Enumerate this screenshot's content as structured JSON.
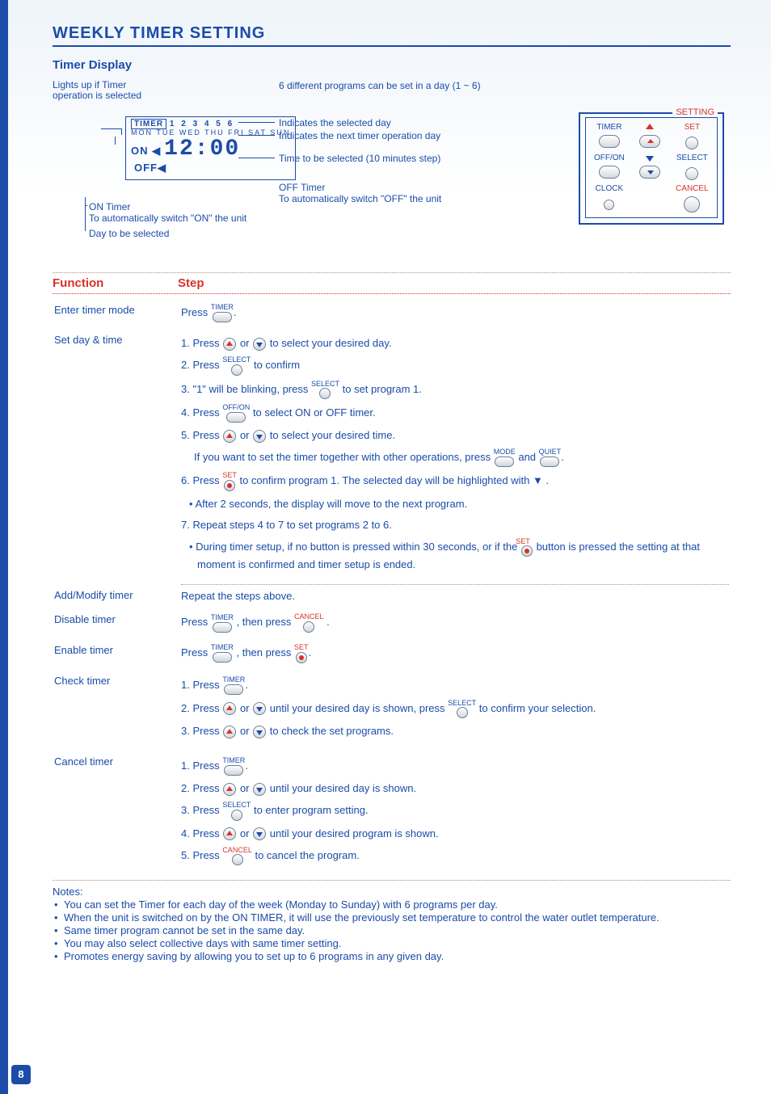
{
  "heading": "WEEKLY TIMER SETTING",
  "timer_display_title": "Timer Display",
  "diagram": {
    "lights_up": "Lights up if Timer operation is selected",
    "six_programs": "6 different programs can be set in a day (1 ~ 6)",
    "indicates_selected": "Indicates the selected day",
    "indicates_next": "Indicates the next timer operation day",
    "time_step": "Time to be selected (10 minutes step)",
    "off_timer_title": "OFF Timer",
    "off_timer_desc": "To automatically switch \"OFF\" the unit",
    "on_timer_title": "ON Timer",
    "on_timer_desc": "To automatically switch \"ON\" the unit",
    "day_selected": "Day to be selected",
    "lcd": {
      "timer_label": "TIMER",
      "nums": "1 2 3 4 5 6",
      "days": "MON TUE WED THU FRI SAT SUN",
      "on": "ON ◀",
      "time": "12:00",
      "off": "OFF◀"
    }
  },
  "panel": {
    "setting": "SETTING",
    "timer": "TIMER",
    "set": "SET",
    "offon": "OFF/ON",
    "select": "SELECT",
    "clock": "CLOCK",
    "cancel": "CANCEL"
  },
  "cols": {
    "function": "Function",
    "step": "Step"
  },
  "rows": {
    "enter": "Enter timer mode",
    "setday": "Set day & time",
    "addmod": "Add/Modify timer",
    "disable": "Disable timer",
    "enable": "Enable timer",
    "check": "Check timer",
    "cancel": "Cancel timer"
  },
  "labels_over": {
    "timer": "TIMER",
    "select": "SELECT",
    "offon": "OFF/ON",
    "set": "SET",
    "mode": "MODE",
    "quiet": "QUIET",
    "cancel": "CANCEL"
  },
  "steps": {
    "enter_press": "Press",
    "set1a": "1. Press",
    "set1b": "or",
    "set1c": "to select your desired day.",
    "set2a": "2. Press",
    "set2b": "to confirm",
    "set3a": "3. \"1\" will be blinking, press",
    "set3b": "to set program 1.",
    "set4a": "4. Press",
    "set4b": "to select ON or OFF timer.",
    "set5a": "5. Press",
    "set5b": "or",
    "set5c": "to select your desired time.",
    "set5d": "If you want to set the timer together with other operations, press",
    "set5e": "and",
    "set6a": "6. Press",
    "set6b": "to confirm program 1. The selected day will be highlighted with ▼ .",
    "set6c": "• After 2 seconds, the display will move to the next program.",
    "set7a": "7. Repeat steps 4 to 7 to set programs 2 to 6.",
    "set7b": "• During timer setup, if no button is pressed within 30 seconds, or if the",
    "set7c": "button is pressed the setting at that moment is confirmed and timer setup is ended.",
    "addmod": "Repeat the steps above.",
    "disable_a": "Press",
    "disable_b": ", then press",
    "enable_a": "Press",
    "enable_b": ", then press",
    "check1": "1. Press",
    "check2a": "2. Press",
    "check2b": "or",
    "check2c": "until your desired day is shown, press",
    "check2d": "to confirm your selection.",
    "check3a": "3. Press",
    "check3b": "or",
    "check3c": "to check the set programs.",
    "can1": "1. Press",
    "can2a": "2. Press",
    "can2b": "or",
    "can2c": "until your desired day is shown.",
    "can3a": "3. Press",
    "can3b": "to enter program setting.",
    "can4a": "4. Press",
    "can4b": "or",
    "can4c": "until your desired program is shown.",
    "can5a": "5. Press",
    "can5b": "to cancel the program."
  },
  "notes": {
    "title": "Notes:",
    "n1": "You can set the Timer for each day of the week (Monday to Sunday) with 6 programs per day.",
    "n2": "When the unit is switched on by the ON TIMER, it will use the previously set temperature to control the water outlet temperature.",
    "n3": "Same timer program cannot be set in the same day.",
    "n4": "You may also select collective days with same timer setting.",
    "n5": "Promotes energy saving by allowing you to set up to 6 programs in any given day."
  },
  "page": "8"
}
